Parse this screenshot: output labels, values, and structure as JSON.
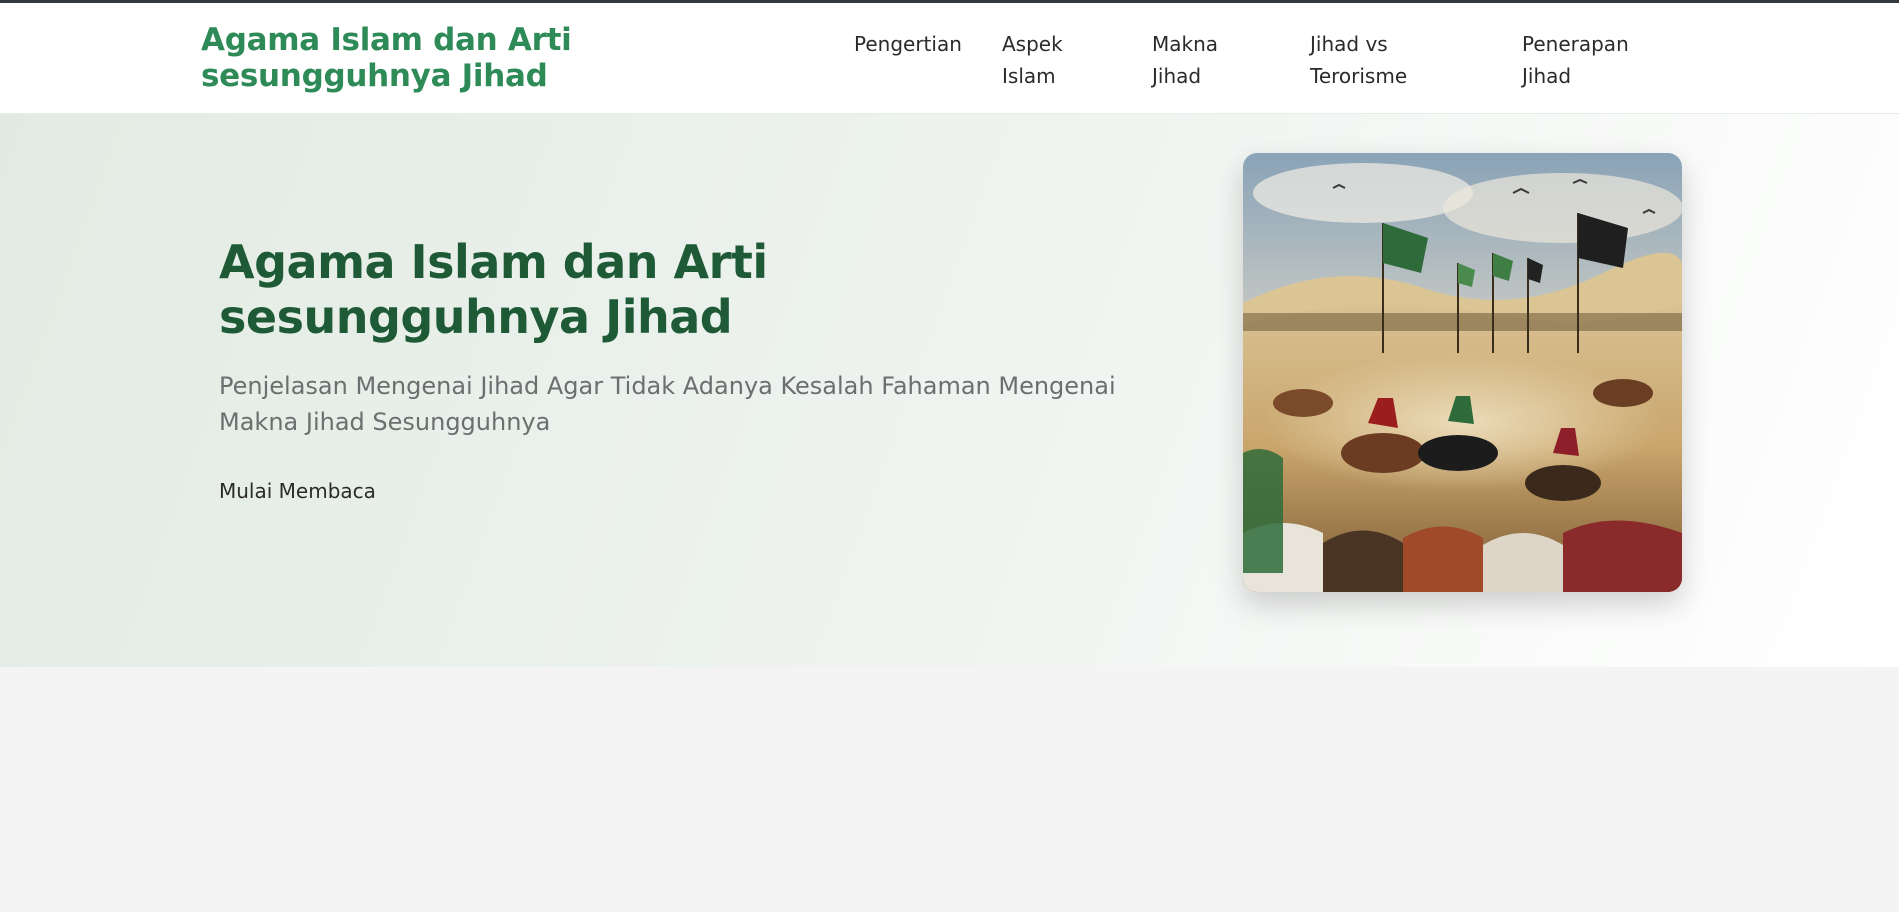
{
  "header": {
    "brand": "Agama Islam dan Arti sesungguhnya Jihad",
    "nav": [
      {
        "line1": "Pengertian",
        "line2": ""
      },
      {
        "line1": "Aspek",
        "line2": "Islam"
      },
      {
        "line1": "Makna",
        "line2": "Jihad"
      },
      {
        "line1": "Jihad vs",
        "line2": "Terorisme"
      },
      {
        "line1": "Penerapan",
        "line2": "Jihad"
      }
    ]
  },
  "hero": {
    "title": "Agama Islam dan Arti sesungguhnya Jihad",
    "subtitle": "Penjelasan Mengenai Jihad Agar Tidak Adanya Kesalah Fahaman Mengenai Makna Jihad Sesungguhnya",
    "cta": "Mulai Membaca",
    "image_subject": "painting of cavalry charging across desert with green and black banners"
  },
  "colors": {
    "brand_green": "#2e8b57",
    "title_green": "#1e5a36",
    "subtitle_gray": "#6b6f70",
    "page_bg": "#f3f4f3"
  }
}
